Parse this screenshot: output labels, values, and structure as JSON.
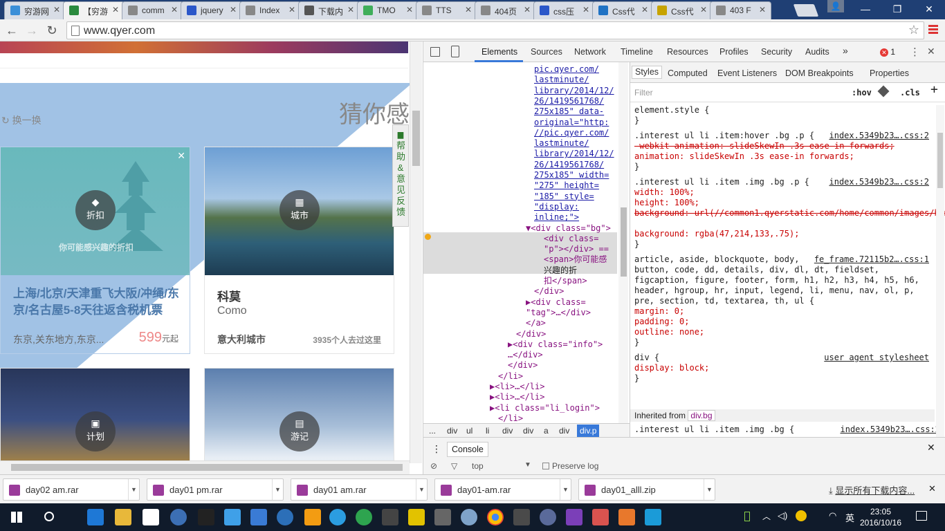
{
  "tabs": [
    {
      "title": "穷游网",
      "active": false,
      "color": "#3a8fd8"
    },
    {
      "title": "【穷游",
      "active": true,
      "color": "#2b8a3e"
    },
    {
      "title": "comm",
      "active": false,
      "color": "#888"
    },
    {
      "title": "jquery",
      "active": false,
      "color": "#2b57c9"
    },
    {
      "title": "Index",
      "active": false,
      "color": "#888"
    },
    {
      "title": "下载内",
      "active": false,
      "color": "#555"
    },
    {
      "title": "TMO",
      "active": false,
      "color": "#3fae5a"
    },
    {
      "title": "TTS",
      "active": false,
      "color": "#888"
    },
    {
      "title": "404页",
      "active": false,
      "color": "#888"
    },
    {
      "title": "css压",
      "active": false,
      "color": "#2b57c9"
    },
    {
      "title": "Css代",
      "active": false,
      "color": "#1f72c4"
    },
    {
      "title": "Css代",
      "active": false,
      "color": "#c7a300"
    },
    {
      "title": "403 F",
      "active": false,
      "color": "#888"
    }
  ],
  "browser": {
    "url": "www.qyer.com"
  },
  "page": {
    "guess_title": "猜你感",
    "refresh_label": "换一换",
    "feedback_label": "帮助&意见反馈",
    "cards": [
      {
        "tag_label": "折扣",
        "tag_icon": "discount-icon",
        "overlay_caption": "你可能感兴趣的折扣",
        "title": "上海/北京/天津重飞大阪/冲绳/东京/名古屋5-8天往返含税机票",
        "subtitle": "东京,关东地方,东京...",
        "price": "599",
        "price_unit": "元起"
      },
      {
        "tag_label": "城市",
        "tag_icon": "city-icon",
        "title": "科莫",
        "subtitle": "Como",
        "meta_left": "意大利城市",
        "meta_right": "3935个人去过这里"
      },
      {
        "tag_label": "计划",
        "tag_icon": "plan-icon"
      },
      {
        "tag_label": "游记",
        "tag_icon": "travelogue-icon"
      }
    ]
  },
  "devtools": {
    "tabs": [
      "Elements",
      "Sources",
      "Network",
      "Timeline",
      "Resources",
      "Profiles",
      "Security",
      "Audits"
    ],
    "more": "»",
    "error_count": "1",
    "element_lines": [
      {
        "text": "pic.qyer.com/",
        "cls": "val",
        "indent": 160
      },
      {
        "text": "lastminute/",
        "cls": "val",
        "indent": 160
      },
      {
        "text": "library/2014/12/",
        "cls": "val",
        "indent": 160
      },
      {
        "text": "26/1419561768/",
        "cls": "val",
        "indent": 160
      },
      {
        "text": "275x185\" data-",
        "cls": "val",
        "indent": 160
      },
      {
        "text": "original=\"http:",
        "cls": "val",
        "indent": 160
      },
      {
        "text": "//pic.qyer.com/",
        "cls": "val",
        "indent": 160
      },
      {
        "text": "lastminute/",
        "cls": "val",
        "indent": 160
      },
      {
        "text": "library/2014/12/",
        "cls": "val",
        "indent": 160
      },
      {
        "text": "26/1419561768/",
        "cls": "val",
        "indent": 160
      },
      {
        "text": "275x185\" width=",
        "cls": "val",
        "indent": 160
      },
      {
        "text": "\"275\" height=",
        "cls": "val",
        "indent": 160
      },
      {
        "text": "\"185\" style=",
        "cls": "val",
        "indent": 160
      },
      {
        "text": "\"display:",
        "cls": "val",
        "indent": 160
      },
      {
        "text": "inline;\">",
        "cls": "val",
        "indent": 160
      },
      {
        "text": "▼<div class=\"bg\">",
        "cls": "tag",
        "indent": 148
      },
      {
        "text": "<div class=",
        "cls": "tag",
        "indent": 174
      },
      {
        "text": "\"p\"></div> ==",
        "cls": "tag",
        "indent": 174
      },
      {
        "text": "<span>你可能感",
        "cls": "tag",
        "indent": 174
      },
      {
        "text": "兴趣的折",
        "cls": "txt",
        "indent": 174
      },
      {
        "text": "扣</span>",
        "cls": "tag",
        "indent": 174
      },
      {
        "text": "</div>",
        "cls": "tag",
        "indent": 160
      },
      {
        "text": "▶<div class=",
        "cls": "tag",
        "indent": 148
      },
      {
        "text": "\"tag\">…</div>",
        "cls": "tag",
        "indent": 148
      },
      {
        "text": "</a>",
        "cls": "tag",
        "indent": 148
      },
      {
        "text": "</div>",
        "cls": "tag",
        "indent": 134
      },
      {
        "text": "▶<div class=\"info\">",
        "cls": "tag",
        "indent": 122
      },
      {
        "text": "…</div>",
        "cls": "tag",
        "indent": 122
      },
      {
        "text": "</div>",
        "cls": "tag",
        "indent": 122
      },
      {
        "text": "</li>",
        "cls": "tag",
        "indent": 108
      },
      {
        "text": "▶<li>…</li>",
        "cls": "tag",
        "indent": 96
      },
      {
        "text": "▶<li>…</li>",
        "cls": "tag",
        "indent": 96
      },
      {
        "text": "▶<li class=\"li_login\">",
        "cls": "tag",
        "indent": 96
      },
      {
        "text": "</li>",
        "cls": "tag",
        "indent": 108
      }
    ],
    "breadcrumbs": [
      "...",
      "div",
      "ul",
      "li",
      "div",
      "div",
      "a",
      "div",
      "div.p"
    ],
    "style_tabs": [
      "Styles",
      "Computed",
      "Event Listeners",
      "DOM Breakpoints",
      "Properties"
    ],
    "filter_placeholder": "Filter",
    "filter_hov": ":hov",
    "filter_cls": ".cls",
    "style_lines": [
      {
        "text": "element.style {",
        "cls": "txt"
      },
      {
        "text": "}",
        "cls": "txt"
      },
      {
        "text": ".interest ul li .item:hover .bg .p {",
        "cls": "txt",
        "src": "index.5349b23….css:2"
      },
      {
        "text": "  -webkit-animation: slideSkewIn .3s ease-in forwards;",
        "cls": "strike"
      },
      {
        "text": "  animation: slideSkewIn .3s ease-in forwards;",
        "cls": "prop"
      },
      {
        "text": "}",
        "cls": "txt"
      },
      {
        "text": ".interest ul li .item .img .bg .p {",
        "cls": "txt",
        "src": "index.5349b23….css:2"
      },
      {
        "text": "  width: 100%;",
        "cls": "prop"
      },
      {
        "text": "  height: 100%;",
        "cls": "prop"
      },
      {
        "text": "  background: url(//common1.qyerstatic.com/home/common/images/home…",
        "cls": "strike"
      },
      {
        "text": "",
        "cls": "txt"
      },
      {
        "text": "  background: rgba(47,214,133,.75);",
        "cls": "prop"
      },
      {
        "text": "}",
        "cls": "txt"
      },
      {
        "text": "article, aside, blockquote, body,",
        "cls": "txt",
        "src": "fe_frame.72115b2….css:1"
      },
      {
        "text": "button, code, dd, details, div, dl, dt, fieldset,",
        "cls": "txt"
      },
      {
        "text": "figcaption, figure, footer, form, h1, h2, h3, h4, h5, h6,",
        "cls": "txt"
      },
      {
        "text": "header, hgroup, hr, input, legend, li, menu, nav, ol, p,",
        "cls": "txt"
      },
      {
        "text": "pre, section, td, textarea, th, ul {",
        "cls": "txt"
      },
      {
        "text": "  margin: 0;",
        "cls": "prop"
      },
      {
        "text": "  padding: 0;",
        "cls": "prop"
      },
      {
        "text": "  outline: none;",
        "cls": "prop"
      },
      {
        "text": "}",
        "cls": "txt"
      },
      {
        "text": "div {",
        "cls": "txt",
        "src": "user agent stylesheet"
      },
      {
        "text": "  display: block;",
        "cls": "prop"
      },
      {
        "text": "}",
        "cls": "txt"
      }
    ],
    "inherited_label": "Inherited from",
    "inherited_from": "div.bg",
    "last_rule": ".interest ul li .item .img .bg {",
    "last_rule_src": "index.5349b23….css:2",
    "console_tab": "Console",
    "console_context": "top",
    "preserve_log": "Preserve log"
  },
  "downloads": {
    "items": [
      "day02 am.rar",
      "day01 pm.rar",
      "day01 am.rar",
      "day01-am.rar",
      "day01_alll.zip"
    ],
    "show_all": "显示所有下载内容..."
  },
  "taskbar": {
    "time": "23:05",
    "date": "2016/10/16",
    "ime": "英"
  },
  "colors": {
    "overlay_blue": "#90b7e0",
    "tabbar": "#1f3f74",
    "taskbar": "#101b2b"
  }
}
